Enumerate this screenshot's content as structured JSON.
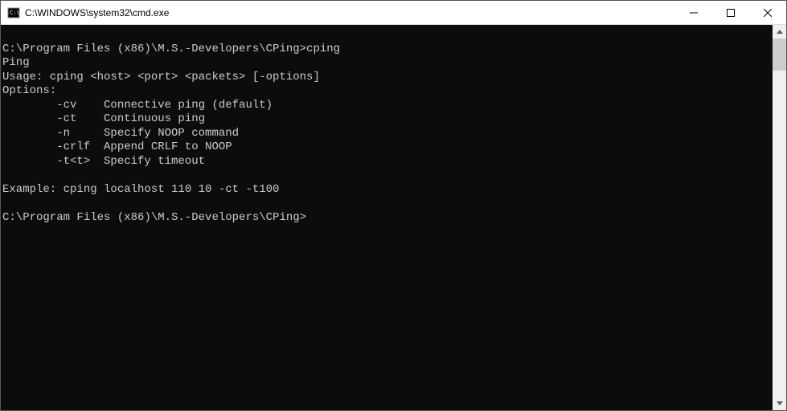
{
  "window": {
    "title": "C:\\WINDOWS\\system32\\cmd.exe"
  },
  "console": {
    "lines": [
      "",
      "C:\\Program Files (x86)\\M.S.-Developers\\CPing>cping",
      "Ping",
      "Usage: cping <host> <port> <packets> [-options]",
      "Options:",
      "        -cv    Connective ping (default)",
      "        -ct    Continuous ping",
      "        -n     Specify NOOP command",
      "        -crlf  Append CRLF to NOOP",
      "        -t<t>  Specify timeout",
      "",
      "Example: cping localhost 110 10 -ct -t100",
      "",
      "C:\\Program Files (x86)\\M.S.-Developers\\CPing>"
    ]
  }
}
